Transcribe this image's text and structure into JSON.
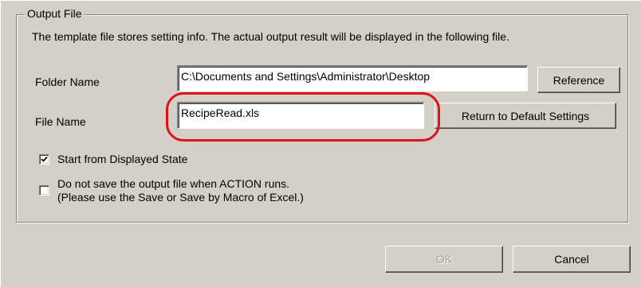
{
  "group": {
    "title": "Output File"
  },
  "description": "The template file stores setting info. The actual output result will be displayed in the following file.",
  "folder": {
    "label": "Folder Name",
    "value": "C:\\Documents and Settings\\Administrator\\Desktop",
    "button": "Reference"
  },
  "file": {
    "label": "File Name",
    "value": "RecipeRead.xls",
    "button": "Return to Default Settings"
  },
  "options": {
    "start_displayed": {
      "label": "Start from Displayed State",
      "checked": true
    },
    "no_save": {
      "label_line1": "Do not save the output file when ACTION runs.",
      "label_line2": "(Please use the Save or Save by Macro of Excel.)",
      "checked": false
    }
  },
  "footer": {
    "ok": "OK",
    "ok_enabled": false,
    "cancel": "Cancel"
  },
  "colors": {
    "dialog_bg": "#d4d0c8",
    "highlight": "#e0101a"
  }
}
